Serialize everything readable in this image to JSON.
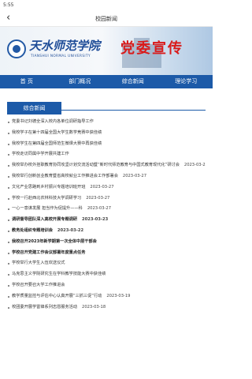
{
  "status": {
    "time": "5:55"
  },
  "header": {
    "title": "校园新闻",
    "back_icon": "chevron-left-icon"
  },
  "banner": {
    "school_cn": "天水师范学院",
    "school_en": "TIANSHUI NORMAL UNIVERSITY",
    "slogan": "党委宣传"
  },
  "nav": {
    "items": [
      "首 页",
      "部门概况",
      "综合新闻",
      "理论学习"
    ]
  },
  "tab": {
    "label": "综合新闻"
  },
  "news": [
    {
      "title": "党委书记刘德全深入校内各单位调研指导工作",
      "date": ""
    },
    {
      "title": "我校学子在第十四届全国大学生数学竞赛中获佳绩",
      "date": ""
    },
    {
      "title": "我校学生在第四届全国师范生微课大赛中再获佳绩",
      "date": ""
    },
    {
      "title": "学校走访同属中学开展共建工作",
      "date": ""
    },
    {
      "title": "我校举办校外挂职教育协同攻坚计划交流活动暨“新时代师范教育与中国式教育现代化”研讨会",
      "date": "2023-03-27"
    },
    {
      "title": "我校举行创新创业教育暨省高校就业工作推进会工作部署会",
      "date": "2023-03-27"
    },
    {
      "title": "文化产业思路到乡村振兴专题培训班开班",
      "date": "2023-03-27"
    },
    {
      "title": "学校一行赴西北农林科技大学调研学习",
      "date": "2023-03-27"
    },
    {
      "title": "一心一意谋发展 担当作为促提升——科",
      "date": "2023-03-27"
    },
    {
      "title": "调研督导团队深入高校开展专题调研",
      "date": "2023-03-23"
    },
    {
      "title": "教务处组织专题培训会",
      "date": "2023-03-22"
    },
    {
      "title": "我校召开2023年新学期第一次全体中层干部会",
      "date": ""
    },
    {
      "title": "学校召开党建工作会议部署年度重点任务",
      "date": ""
    },
    {
      "title": "学校举行大学生入伍欢送仪式",
      "date": ""
    },
    {
      "title": "马克思主义学院研究生在学科教学技能大赛中获佳绩",
      "date": ""
    },
    {
      "title": "学校召开要召大学工作推进会",
      "date": ""
    },
    {
      "title": "教学质量监控与评估中心认真开展“三抓三促”行动",
      "date": "2023-03-19"
    },
    {
      "title": "校团委开展学雷锋系列志愿服务活动",
      "date": "2023-03-18"
    }
  ]
}
